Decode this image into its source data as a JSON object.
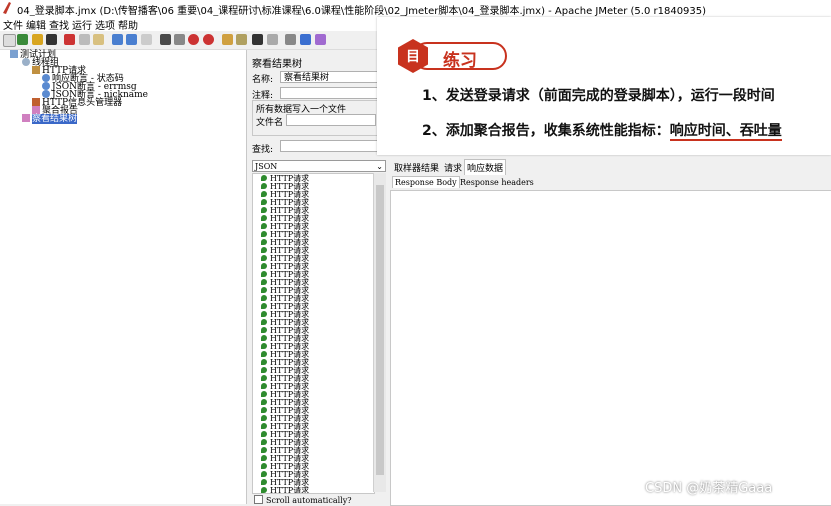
{
  "window": {
    "title": "04_登录脚本.jmx (D:\\传智播客\\06 重要\\04_课程研讨\\标准课程\\6.0课程\\性能阶段\\02_Jmeter脚本\\04_登录脚本.jmx) - Apache JMeter (5.0 r1840935)"
  },
  "menu": [
    "文件",
    "编辑",
    "查找",
    "运行",
    "选项",
    "帮助"
  ],
  "tree": {
    "items": [
      {
        "label": "测试计划",
        "icon": "test-plan-icon"
      },
      {
        "label": "线程组",
        "icon": "thread-group-icon"
      },
      {
        "label": "HTTP请求",
        "icon": "http-sampler-icon"
      },
      {
        "label": "响应断言 - 状态码",
        "icon": "assertion-icon"
      },
      {
        "label": "JSON断言 - errmsg",
        "icon": "assertion-icon"
      },
      {
        "label": "JSON断言 - nickname",
        "icon": "assertion-icon"
      },
      {
        "label": "HTTP信息头管理器",
        "icon": "header-manager-icon"
      },
      {
        "label": "聚合报告",
        "icon": "listener-icon"
      },
      {
        "label": "察看结果树",
        "icon": "listener-icon"
      }
    ]
  },
  "panel": {
    "title": "察看结果树",
    "name_label": "名称:",
    "name_value": "察看结果树",
    "comment_label": "注释:",
    "file_section": "所有数据写入一个文件",
    "filename_label": "文件名",
    "search_label": "查找:",
    "renderer": "JSON",
    "result_item": "HTTP请求",
    "scroll_auto": "Scroll automatically?"
  },
  "tabs": {
    "top": [
      "取样器结果",
      "请求",
      "响应数据"
    ],
    "sub": [
      "Response Body",
      "Response headers"
    ]
  },
  "overlay": {
    "badge": "练习",
    "badge_icon": "目",
    "line1": "1、发送登录请求（前面完成的登录脚本），运行一段时间",
    "line2_prefix": "2、添加聚合报告，收集系统性能指标：",
    "line2_metrics": "响应时间、吞吐量"
  },
  "watermark": "CSDN @奶茶精Gaaa"
}
